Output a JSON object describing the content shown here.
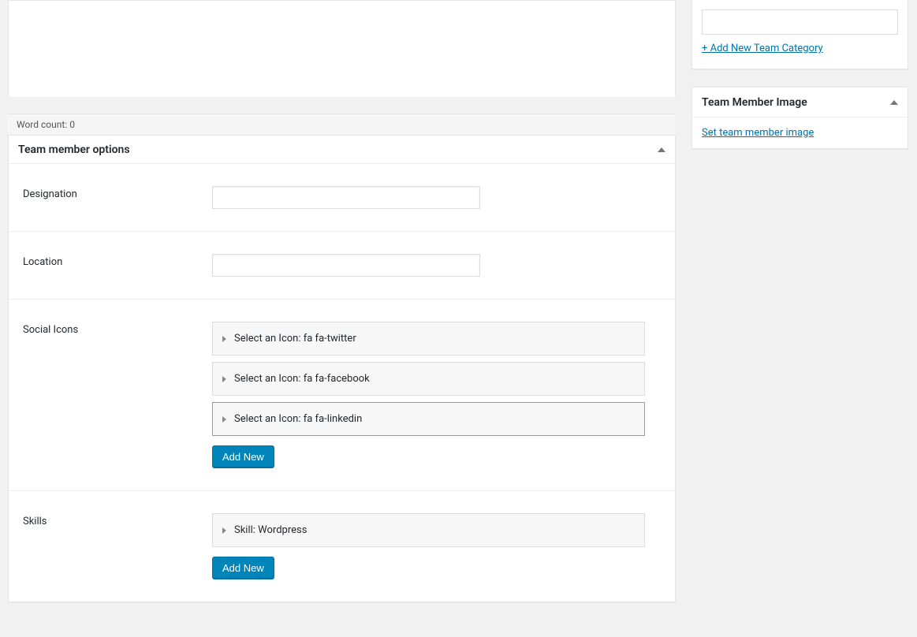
{
  "editor": {
    "wordcount_label": "Word count:",
    "wordcount_value": "0"
  },
  "options_panel": {
    "title": "Team member options",
    "fields": {
      "designation_label": "Designation",
      "location_label": "Location",
      "social_icons_label": "Social Icons",
      "skills_label": "Skills"
    },
    "social_icons": [
      {
        "label": "Select an Icon: fa fa-twitter"
      },
      {
        "label": "Select an Icon: fa fa-facebook"
      },
      {
        "label": "Select an Icon: fa fa-linkedin"
      }
    ],
    "skills": [
      {
        "label": "Skill: Wordpress"
      }
    ],
    "add_new_label": "Add New"
  },
  "sidebar": {
    "category": {
      "add_link": "+ Add New Team Category"
    },
    "image_panel": {
      "title": "Team Member Image",
      "set_link": "Set team member image"
    }
  }
}
